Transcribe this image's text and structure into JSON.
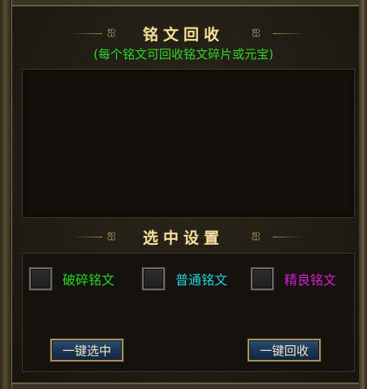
{
  "recycle": {
    "title": "铭文回收",
    "subtitle": "(每个铭文可回收铭文碎片或元宝)"
  },
  "settings": {
    "title": "选中设置",
    "options": [
      {
        "label": "破碎铭文",
        "color": "#23d623",
        "checked": false
      },
      {
        "label": "普通铭文",
        "color": "#21d6e0",
        "checked": false
      },
      {
        "label": "精良铭文",
        "color": "#d61fd6",
        "checked": false
      }
    ]
  },
  "buttons": {
    "select_all": "一键选中",
    "recycle_all": "一键回收"
  },
  "ornament": "ஐ"
}
